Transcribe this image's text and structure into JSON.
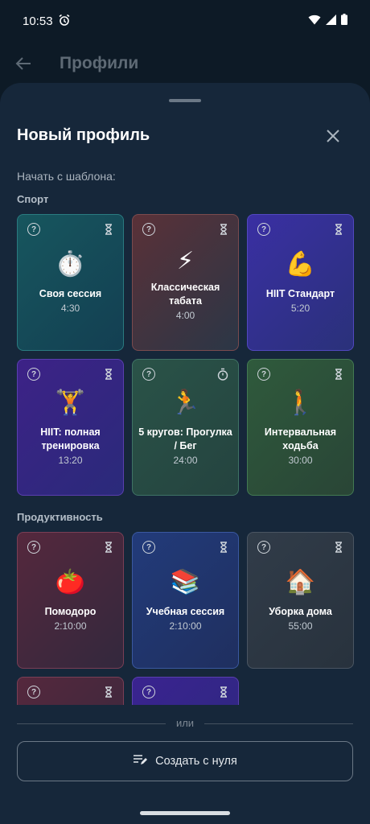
{
  "status_bar": {
    "time": "10:53"
  },
  "app_bar": {
    "title": "Профили"
  },
  "sheet": {
    "title": "Новый профиль",
    "subtitle": "Начать с шаблона:",
    "sections": [
      {
        "label": "Спорт",
        "cards": [
          {
            "emoji": "⏱️",
            "name": "Своя сессия",
            "duration": "4:30",
            "color": "#17565e",
            "timer_icon": "hourglass-icon"
          },
          {
            "emoji": "⚡",
            "name": "Классическая табата",
            "duration": "4:00",
            "color": "#5a3138",
            "timer_icon": "hourglass-icon"
          },
          {
            "emoji": "💪",
            "name": "HIIT Стандарт",
            "duration": "5:20",
            "color": "#3a2fa3",
            "timer_icon": "hourglass-icon"
          },
          {
            "emoji": "🏋️",
            "name": "HIIT: полная тренировка",
            "duration": "13:20",
            "color": "#3d2287",
            "timer_icon": "hourglass-icon"
          },
          {
            "emoji": "🏃",
            "name": "5 кругов: Прогулка / Бег",
            "duration": "24:00",
            "color": "#2a5348",
            "timer_icon": "stopwatch-icon"
          },
          {
            "emoji": "🚶",
            "name": "Интервальная ходьба",
            "duration": "30:00",
            "color": "#2f5a3c",
            "timer_icon": "hourglass-icon"
          }
        ]
      },
      {
        "label": "Продуктивность",
        "cards": [
          {
            "emoji": "🍅",
            "name": "Помодоро",
            "duration": "2:10:00",
            "color": "#55283d",
            "timer_icon": "hourglass-icon"
          },
          {
            "emoji": "📚",
            "name": "Учебная сессия",
            "duration": "2:10:00",
            "color": "#223b7a",
            "timer_icon": "hourglass-icon"
          },
          {
            "emoji": "🏠",
            "name": "Уборка дома",
            "duration": "55:00",
            "color": "#313c49",
            "timer_icon": "hourglass-icon"
          }
        ]
      }
    ],
    "divider_text": "или",
    "create_button_label": "Создать с нуля"
  }
}
